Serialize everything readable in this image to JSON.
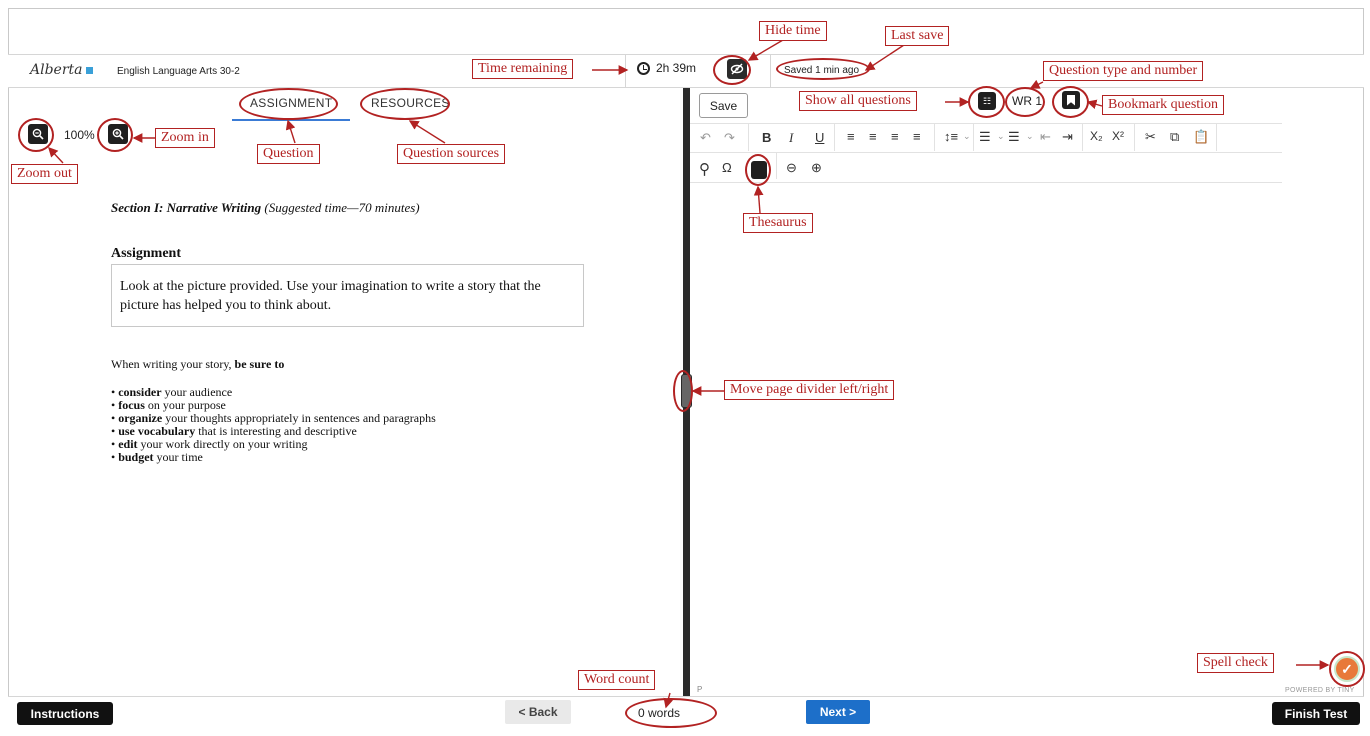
{
  "header": {
    "logo": "Alberta",
    "course": "English Language Arts 30-2",
    "time_remaining": "2h 39m",
    "saved_status": "Saved 1 min ago"
  },
  "left_pane": {
    "tabs": [
      "ASSIGNMENT",
      "RESOURCES"
    ],
    "zoom_level": "100%",
    "section_title": "Section I: Narrative Writing",
    "section_time": "(Suggested time—70 minutes)",
    "assignment_heading": "Assignment",
    "assignment_text": "Look at the picture provided. Use your imagination to write a story that the picture has helped you to think about.",
    "be_sure_prefix": "When writing your story,",
    "be_sure_bold": "be sure to",
    "bullets": [
      {
        "bold": "consider",
        "rest": " your audience"
      },
      {
        "bold": "focus",
        "rest": " on your purpose"
      },
      {
        "bold": "organize",
        "rest": " your thoughts appropriately in sentences and paragraphs"
      },
      {
        "bold": "use vocabulary",
        "rest": " that is interesting and descriptive"
      },
      {
        "bold": "edit",
        "rest": " your work directly on your writing"
      },
      {
        "bold": "budget",
        "rest": " your time"
      }
    ]
  },
  "right_pane": {
    "save_label": "Save",
    "question_number": "WR 1",
    "editor_path": "P",
    "powered_by": "POWERED BY TINY"
  },
  "footer": {
    "instructions_label": "Instructions",
    "back_label": "< Back",
    "word_count": "0 words",
    "next_label": "Next >",
    "finish_label": "Finish Test"
  },
  "annotations": {
    "hide_time": "Hide time",
    "last_save": "Last save",
    "time_remaining": "Time remaining",
    "question_type_and_number": "Question type and number",
    "show_all_questions": "Show all questions",
    "bookmark_question": "Bookmark question",
    "zoom_in": "Zoom in",
    "zoom_out": "Zoom out",
    "question": "Question",
    "question_sources": "Question sources",
    "thesaurus": "Thesaurus",
    "move_divider": "Move page divider left/right",
    "spell_check": "Spell check",
    "word_count": "Word count"
  },
  "colors": {
    "annotation": "#b22222",
    "accent_blue": "#1d6fc9",
    "button_dark": "#111111",
    "spell_check": "#e8793a"
  }
}
